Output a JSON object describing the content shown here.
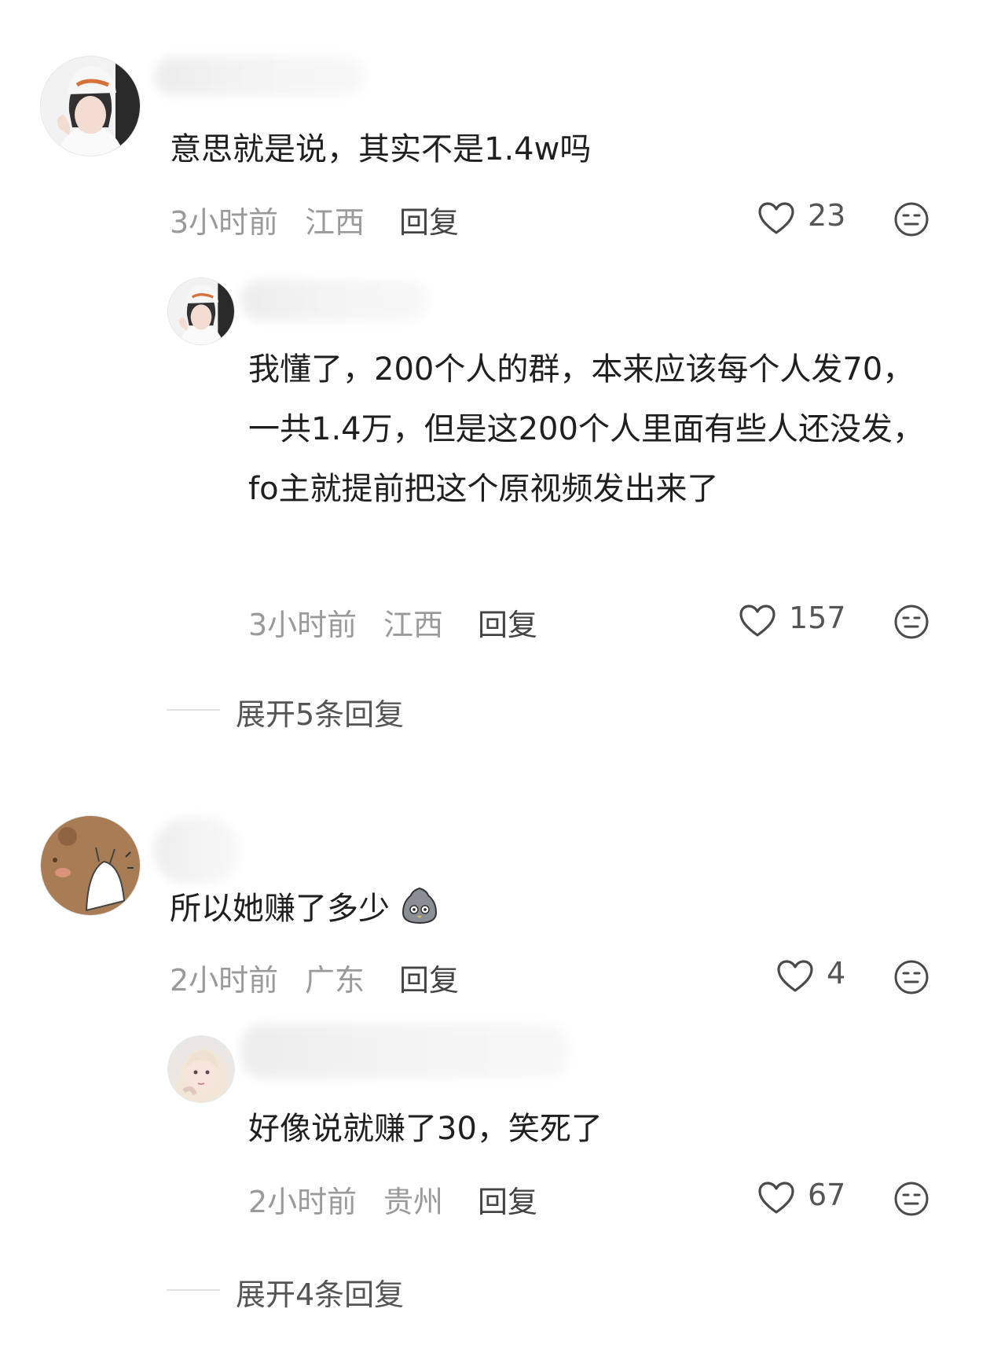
{
  "threads": [
    {
      "comment": {
        "text": "意思就是说，其实不是1.4w吗",
        "time": "3小时前",
        "location": "江西",
        "reply_label": "回复",
        "likes": "23"
      },
      "reply": {
        "text": "我懂了，200个人的群，本来应该每个人发70，一共1.4万，但是这200个人里面有些人还没发，fo主就提前把这个原视频发出来了",
        "time": "3小时前",
        "location": "江西",
        "reply_label": "回复",
        "likes": "157"
      },
      "expand_label": "展开5条回复"
    },
    {
      "comment": {
        "text": "所以她赚了多少",
        "time": "2小时前",
        "location": "广东",
        "reply_label": "回复",
        "likes": "4"
      },
      "reply": {
        "text": "好像说就赚了30，笑死了",
        "time": "2小时前",
        "location": "贵州",
        "reply_label": "回复",
        "likes": "67"
      },
      "expand_label": "展开4条回复"
    }
  ],
  "icons": {
    "like": "heart-outline-icon",
    "dislike": "neutral-face-icon",
    "emoji": "grey-bird-emoji-icon"
  },
  "colors": {
    "meta": "#9a9a9a",
    "text": "#1f1f1f",
    "divider": "#e2e2e2"
  }
}
